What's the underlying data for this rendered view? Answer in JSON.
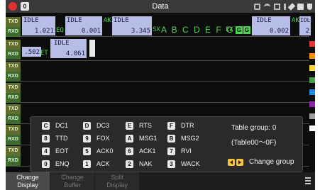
{
  "titlebar": {
    "title": "Data",
    "badge": "0"
  },
  "rows": {
    "txd": "TXD",
    "rxd": "RXD"
  },
  "line1": {
    "cells": [
      {
        "top": "IDLE",
        "bottom": "1.021"
      },
      {
        "top": "IDLE",
        "bottom": "0.001"
      },
      {
        "top": "IDLE",
        "bottom": "3.345"
      },
      {
        "top": "IDLE",
        "bottom": "0.002"
      },
      {
        "top": "IDLE",
        "bottom": "2"
      }
    ],
    "eq": "EQ",
    "ak": "AK",
    "sx": "SX",
    "letters": "A B C D E F G",
    "ex": "EX",
    "g1": "G",
    "g2": "G",
    "ak2": "AK"
  },
  "line2": {
    "left_value": ".502",
    "et": "ET",
    "cell": {
      "top": "IDLE",
      "bottom": "4.061"
    }
  },
  "popup": {
    "keys": [
      {
        "k": "C",
        "v": "DC1"
      },
      {
        "k": "D",
        "v": "DC3"
      },
      {
        "k": "E",
        "v": "RTS"
      },
      {
        "k": "F",
        "v": "DTR"
      },
      {
        "k": "8",
        "v": "TTD"
      },
      {
        "k": "9",
        "v": "FOX"
      },
      {
        "k": "A",
        "v": "MSG1"
      },
      {
        "k": "B",
        "v": "MSG2"
      },
      {
        "k": "4",
        "v": "EOT"
      },
      {
        "k": "5",
        "v": "ACK0"
      },
      {
        "k": "6",
        "v": "ACK1"
      },
      {
        "k": "7",
        "v": "RVI"
      },
      {
        "k": "0",
        "v": "ENQ"
      },
      {
        "k": "1",
        "v": "ACK"
      },
      {
        "k": "2",
        "v": "NAK"
      },
      {
        "k": "3",
        "v": "WACK"
      }
    ],
    "table_group": "Table group:  0",
    "table_range": "(Table00〜0F)",
    "change_group": "Change group"
  },
  "function_bar": {
    "buttons": [
      {
        "line1": "Change",
        "line2": "Display",
        "active": true
      },
      {
        "line1": "Change",
        "line2": "Buffer",
        "active": false
      },
      {
        "line1": "Split",
        "line2": "Display",
        "active": false
      }
    ]
  },
  "colors": {
    "accent_green": "#4fd24f",
    "cell_bg": "#b7bde6",
    "record_dot": "#e03030"
  },
  "strip_colors": [
    "#e53935",
    "#fb8c00",
    "#fdd835",
    "#43a047",
    "#1e88e5",
    "#8e24aa",
    "#9e9e9e",
    "#ffffff"
  ]
}
